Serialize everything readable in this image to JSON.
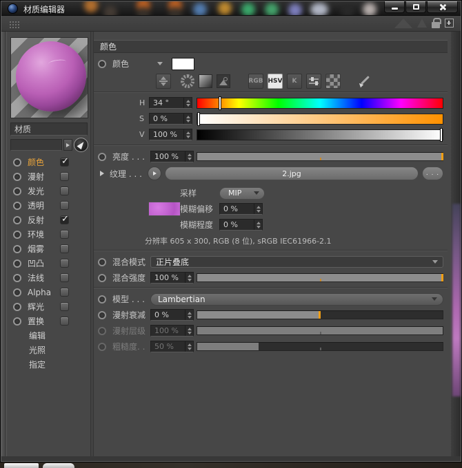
{
  "window": {
    "title": "材质编辑器"
  },
  "sidebar": {
    "material_name": "材质",
    "channels": [
      {
        "label": "颜色",
        "checked": true,
        "active": true
      },
      {
        "label": "漫射",
        "checked": false
      },
      {
        "label": "发光",
        "checked": false
      },
      {
        "label": "透明",
        "checked": false
      },
      {
        "label": "反射",
        "checked": true
      },
      {
        "label": "环境",
        "checked": false
      },
      {
        "label": "烟雾",
        "checked": false
      },
      {
        "label": "凹凸",
        "checked": false
      },
      {
        "label": "法线",
        "checked": false
      },
      {
        "label": "Alpha",
        "checked": false
      },
      {
        "label": "辉光",
        "checked": false
      },
      {
        "label": "置换",
        "checked": false
      }
    ],
    "pages": [
      {
        "label": "编辑"
      },
      {
        "label": "光照"
      },
      {
        "label": "指定"
      }
    ]
  },
  "panel": {
    "header": "颜色",
    "color": {
      "label": "颜色"
    },
    "mode_buttons": {
      "rgb": "RGB",
      "hsv": "HSV",
      "k": "K"
    },
    "hsv": {
      "h": {
        "label": "H",
        "value": "34 °",
        "pos": 9.4
      },
      "s": {
        "label": "S",
        "value": "0 %",
        "pos": 0.5
      },
      "v": {
        "label": "V",
        "value": "100 %",
        "pos": 99.5
      }
    },
    "brightness": {
      "label": "亮度 . . .",
      "value": "100 %",
      "fill": 100
    },
    "texture": {
      "label": "纹理 . . .",
      "file": "2.jpg",
      "browse": ". . ."
    },
    "sampling": {
      "label": "采样",
      "value": "MIP"
    },
    "blur_offset": {
      "label": "模糊偏移",
      "value": "0 %"
    },
    "blur_scale": {
      "label": "模糊程度",
      "value": "0 %"
    },
    "resolution": "分辨率 605 x 300, RGB (8 位), sRGB IEC61966-2.1",
    "mix_mode": {
      "label": "混合模式",
      "value": "正片叠底"
    },
    "mix_strength": {
      "label": "混合强度",
      "value": "100 %",
      "fill": 100
    },
    "model": {
      "label": "模型 . . .",
      "value": "Lambertian"
    },
    "diffuse_falloff": {
      "label": "漫射衰减",
      "value": "0 %",
      "fill": 50
    },
    "diffuse_level": {
      "label": "漫射层级",
      "value": "100 %",
      "fill": 100,
      "disabled": true
    },
    "roughness": {
      "label": "粗糙度. .",
      "value": "50 %",
      "fill": 25,
      "disabled": true
    }
  },
  "colors": {
    "accent_orange": "#E8A33B",
    "slider_handle": "#F09E15",
    "panel_bg": "#474747",
    "swatch_color": "#FFFFFF"
  }
}
